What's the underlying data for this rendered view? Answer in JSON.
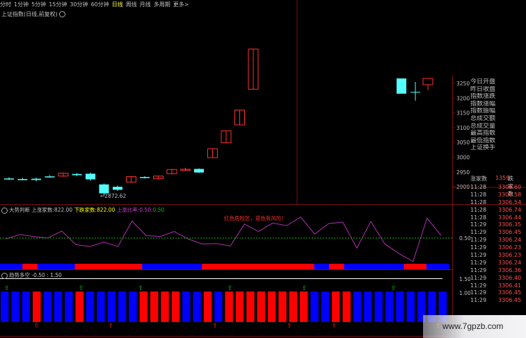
{
  "periods": [
    "分时",
    "1分钟",
    "5分钟",
    "15分钟",
    "30分钟",
    "60分钟",
    "日线",
    "周线",
    "月线",
    "多周期",
    "更多>"
  ],
  "active_period": "日线",
  "main_title": "上证指数(日线,前复权)",
  "y_ticks": [
    "3250",
    "3200",
    "3150",
    "3100",
    "3050",
    "3000",
    "2950",
    "2900"
  ],
  "low_label": "2872.62",
  "info_labels": [
    "今日开盘",
    "昨日收盘",
    "指数涨跌",
    "指数涨幅",
    "指数振幅",
    "总成交额",
    "总成交量",
    "最高指数",
    "最低指数",
    "上证换手"
  ],
  "breadth_header": {
    "up": "涨家数",
    "count": "1359",
    "down": "跌家数"
  },
  "ticks": [
    {
      "t": "11:28",
      "p": "3306.60"
    },
    {
      "t": "11:28",
      "p": "3306.58"
    },
    {
      "t": "11:28",
      "p": "3306.54"
    },
    {
      "t": "11:28",
      "p": "3306.74"
    },
    {
      "t": "11:28",
      "p": "3306.44"
    },
    {
      "t": "11:29",
      "p": "3306.35"
    },
    {
      "t": "11:29",
      "p": "3306.45"
    },
    {
      "t": "11:29",
      "p": "3306.24"
    },
    {
      "t": "11:29",
      "p": "3306.23"
    },
    {
      "t": "11:29",
      "p": "3306.23"
    },
    {
      "t": "11:29",
      "p": "3306.24"
    },
    {
      "t": "11:29",
      "p": "3306.36"
    },
    {
      "t": "11:29",
      "p": "3306.40"
    },
    {
      "t": "11:29",
      "p": "3306.41"
    },
    {
      "t": "11:29",
      "p": "3306.45"
    },
    {
      "t": "11:29",
      "p": "3306.45"
    }
  ],
  "ind1": {
    "name": "大势判断",
    "up_label": "上涨家数:",
    "up_val": "822.00",
    "down_label": "下跌家数:",
    "down_val": "822.00",
    "ratio_label": "上涨比率:",
    "ratio_a": "0.50",
    "ratio_b": "0.50",
    "note": "红色危险区，蓝色有风险！",
    "ref_tick": "0.50"
  },
  "ind2": {
    "name": "趋势多空",
    "a": "-0.50",
    "b": "1.50",
    "tick_hi": "1.50",
    "tick_lo": "1.00"
  },
  "watermark": "www.7gpzb.com",
  "colors": {
    "up": "#ff3232",
    "down": "#54ffff",
    "red_bar": "#ff0000",
    "blue_bar": "#0000ff",
    "line": "#b030b0",
    "dash": "#00c000"
  },
  "chart_data": [
    {
      "type": "candlestick",
      "title": "上证指数(日线,前复权)",
      "ylim": [
        2870,
        3270
      ],
      "candles": [
        {
          "o": 2930,
          "h": 2934,
          "l": 2925,
          "c": 2927
        },
        {
          "o": 2928,
          "h": 2932,
          "l": 2924,
          "c": 2926
        },
        {
          "o": 2929,
          "h": 2933,
          "l": 2920,
          "c": 2925
        },
        {
          "o": 2937,
          "h": 2941,
          "l": 2933,
          "c": 2935
        },
        {
          "o": 2938,
          "h": 2950,
          "l": 2936,
          "c": 2948
        },
        {
          "o": 2945,
          "h": 2948,
          "l": 2938,
          "c": 2941
        },
        {
          "o": 2946,
          "h": 2950,
          "l": 2922,
          "c": 2927
        },
        {
          "o": 2910,
          "h": 2913,
          "l": 2872.62,
          "c": 2880
        },
        {
          "o": 2902,
          "h": 2906,
          "l": 2888,
          "c": 2892
        },
        {
          "o": 2918,
          "h": 2938,
          "l": 2916,
          "c": 2936
        },
        {
          "o": 2935,
          "h": 2938,
          "l": 2930,
          "c": 2932
        },
        {
          "o": 2929,
          "h": 2940,
          "l": 2927,
          "c": 2938
        },
        {
          "o": 2946,
          "h": 2962,
          "l": 2944,
          "c": 2960
        },
        {
          "o": 2960,
          "h": 2966,
          "l": 2955,
          "c": 2961
        },
        {
          "o": 2962,
          "h": 2964,
          "l": 2948,
          "c": 2950
        },
        {
          "o": 3000,
          "h": 3030,
          "l": 3000,
          "c": 3030
        },
        {
          "o": 3050,
          "h": 3090,
          "l": 3048,
          "c": 3090
        },
        {
          "o": 3110,
          "h": 3160,
          "l": 3110,
          "c": 3160
        },
        {
          "o": 3230,
          "h": 3365,
          "l": 3230,
          "c": 3365
        }
      ],
      "right_candles": [
        {
          "o": 3260,
          "h": 3262,
          "l": 3210,
          "c": 3212
        },
        {
          "o": 3225,
          "h": 3245,
          "l": 3195,
          "c": 3222
        },
        {
          "o": 3240,
          "h": 3262,
          "l": 3215,
          "c": 3260
        }
      ]
    },
    {
      "type": "line",
      "title": "大势判断",
      "values": [
        0.48,
        0.57,
        0.53,
        0.5,
        0.64,
        0.37,
        0.33,
        0.42,
        0.33,
        0.84,
        0.55,
        0.53,
        0.63,
        0.48,
        0.38,
        0.39,
        0.34,
        0.78,
        0.63,
        0.8,
        0.75,
        0.92,
        0.58,
        0.79,
        0.82,
        0.3,
        0.83,
        0.38,
        0.19,
        0.03,
        0.9,
        0.55
      ],
      "ref": 0.5,
      "bars": [
        "b",
        "b",
        "b",
        "r",
        "r",
        "b",
        "b",
        "b",
        "b",
        "b",
        "r",
        "r",
        "r",
        "r",
        "r",
        "r",
        "r",
        "r",
        "r",
        "b",
        "b",
        "b",
        "b",
        "b",
        "b",
        "b",
        "b",
        "r",
        "r",
        "r",
        "r",
        "r",
        "r",
        "r",
        "r",
        "r",
        "r",
        "r",
        "r",
        "r",
        "r",
        "r",
        "b",
        "b",
        "r",
        "r",
        "b",
        "b",
        "b",
        "b",
        "b",
        "b",
        "b",
        "b",
        "r",
        "r",
        "r",
        "b",
        "b",
        "b"
      ]
    },
    {
      "type": "bar",
      "title": "趋势多空",
      "bars": [
        "b",
        "b",
        "b",
        "r",
        "b",
        "b",
        "b",
        "r",
        "b",
        "b",
        "b",
        "b",
        "b",
        "r",
        "r",
        "r",
        "r",
        "b",
        "b",
        "r",
        "b",
        "r",
        "r",
        "r",
        "r",
        "r",
        "r",
        "r",
        "r",
        "b",
        "b",
        "r",
        "r",
        "b",
        "b",
        "b",
        "b",
        "b",
        "b",
        "b",
        "b",
        "b"
      ],
      "arrows": [
        {
          "i": 0,
          "dir": "up"
        },
        {
          "i": 2,
          "dir": "down"
        },
        {
          "i": 5,
          "dir": "up"
        },
        {
          "i": 7,
          "dir": "down"
        },
        {
          "i": 9,
          "dir": "up"
        },
        {
          "i": 14,
          "dir": "down"
        },
        {
          "i": 15,
          "dir": "up"
        },
        {
          "i": 19,
          "dir": "down"
        },
        {
          "i": 20,
          "dir": "up"
        },
        {
          "i": 22,
          "dir": "down"
        },
        {
          "i": 26,
          "dir": "up"
        },
        {
          "i": 29,
          "dir": "down"
        }
      ]
    }
  ]
}
